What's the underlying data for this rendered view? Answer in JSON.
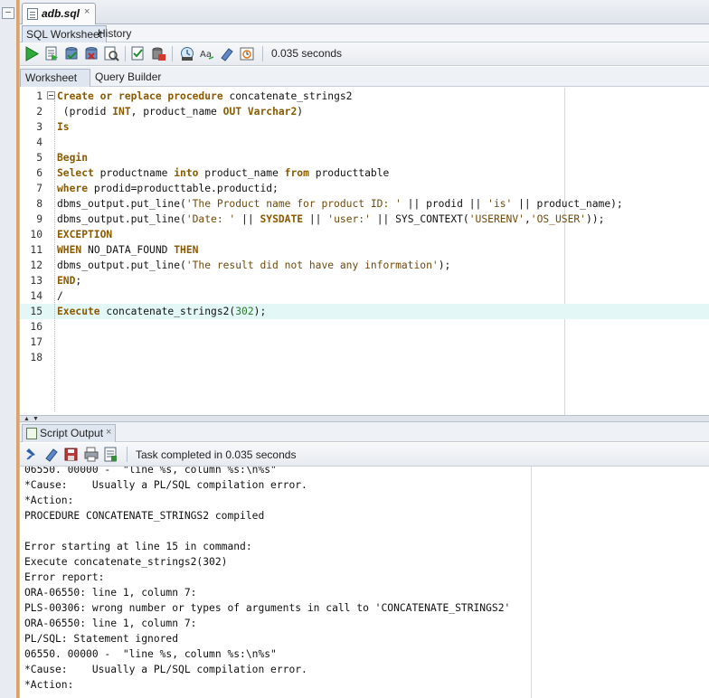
{
  "file_tab": {
    "name": "adb.sql",
    "close": "×"
  },
  "sub_tabs": [
    "SQL Worksheet",
    "History"
  ],
  "toolbar": {
    "icons": [
      "run-statement-icon",
      "run-script-icon",
      "commit-icon",
      "rollback-icon",
      "autotrace-icon",
      "explain-plan-icon",
      "sql-tuning-icon",
      "sql-history-icon",
      "format-icon",
      "clear-icon",
      "timer-icon"
    ],
    "elapsed": "0.035 seconds"
  },
  "worksheet_tabs": [
    "Worksheet",
    "Query Builder"
  ],
  "editor": {
    "current_line": 15,
    "lines": [
      [
        {
          "t": "Create or replace procedure",
          "k": "kw"
        },
        {
          "t": " concatenate_strings2"
        }
      ],
      [
        {
          "t": " (prodid "
        },
        {
          "t": "INT",
          "k": "kw"
        },
        {
          "t": ", product_name "
        },
        {
          "t": "OUT",
          "k": "kw"
        },
        {
          "t": " "
        },
        {
          "t": "Varchar2",
          "k": "kw"
        },
        {
          "t": ")"
        }
      ],
      [
        {
          "t": "Is",
          "k": "kw"
        }
      ],
      [],
      [
        {
          "t": "Begin",
          "k": "kw"
        }
      ],
      [
        {
          "t": "Select",
          "k": "kw"
        },
        {
          "t": " productname "
        },
        {
          "t": "into",
          "k": "kw"
        },
        {
          "t": " product_name "
        },
        {
          "t": "from",
          "k": "kw"
        },
        {
          "t": " producttable"
        }
      ],
      [
        {
          "t": "where",
          "k": "kw"
        },
        {
          "t": " prodid=producttable.productid;"
        }
      ],
      [
        {
          "t": "dbms_output.put_line("
        },
        {
          "t": "'The Product name for product ID: '",
          "k": "str"
        },
        {
          "t": " || prodid || "
        },
        {
          "t": "'is'",
          "k": "str"
        },
        {
          "t": " || product_name);"
        }
      ],
      [
        {
          "t": "dbms_output.put_line("
        },
        {
          "t": "'Date: '",
          "k": "str"
        },
        {
          "t": " || "
        },
        {
          "t": "SYSDATE",
          "k": "kw"
        },
        {
          "t": " || "
        },
        {
          "t": "'user:'",
          "k": "str"
        },
        {
          "t": " || SYS_CONTEXT("
        },
        {
          "t": "'USERENV'",
          "k": "str"
        },
        {
          "t": ","
        },
        {
          "t": "'OS_USER'",
          "k": "str"
        },
        {
          "t": "));"
        }
      ],
      [
        {
          "t": "EXCEPTION",
          "k": "kw"
        }
      ],
      [
        {
          "t": "WHEN",
          "k": "kw"
        },
        {
          "t": " NO_DATA_FOUND "
        },
        {
          "t": "THEN",
          "k": "kw"
        }
      ],
      [
        {
          "t": "dbms_output.put_line("
        },
        {
          "t": "'The result did not have any information'",
          "k": "str"
        },
        {
          "t": ");"
        }
      ],
      [
        {
          "t": "END",
          "k": "kw"
        },
        {
          "t": ";"
        }
      ],
      [
        {
          "t": "/"
        }
      ],
      [
        {
          "t": "Execute",
          "k": "kw"
        },
        {
          "t": " concatenate_strings2("
        },
        {
          "t": "302",
          "k": "num"
        },
        {
          "t": ");"
        }
      ],
      [],
      [],
      []
    ]
  },
  "output_tab": {
    "label": "Script Output",
    "close": "×"
  },
  "output_toolbar": {
    "icons": [
      "pin-icon",
      "eraser-icon",
      "save-icon",
      "print-icon",
      "open-icon"
    ],
    "status": "Task completed in 0.035 seconds"
  },
  "output_lines": [
    "06550. 00000 -  \"line %s, column %s:\\n%s\"",
    "*Cause:    Usually a PL/SQL compilation error.",
    "*Action:",
    "PROCEDURE CONCATENATE_STRINGS2 compiled",
    "",
    "Error starting at line 15 in command:",
    "Execute concatenate_strings2(302)",
    "Error report:",
    "ORA-06550: line 1, column 7:",
    "PLS-00306: wrong number or types of arguments in call to 'CONCATENATE_STRINGS2'",
    "ORA-06550: line 1, column 7:",
    "PL/SQL: Statement ignored",
    "06550. 00000 -  \"line %s, column %s:\\n%s\"",
    "*Cause:    Usually a PL/SQL compilation error.",
    "*Action:"
  ]
}
